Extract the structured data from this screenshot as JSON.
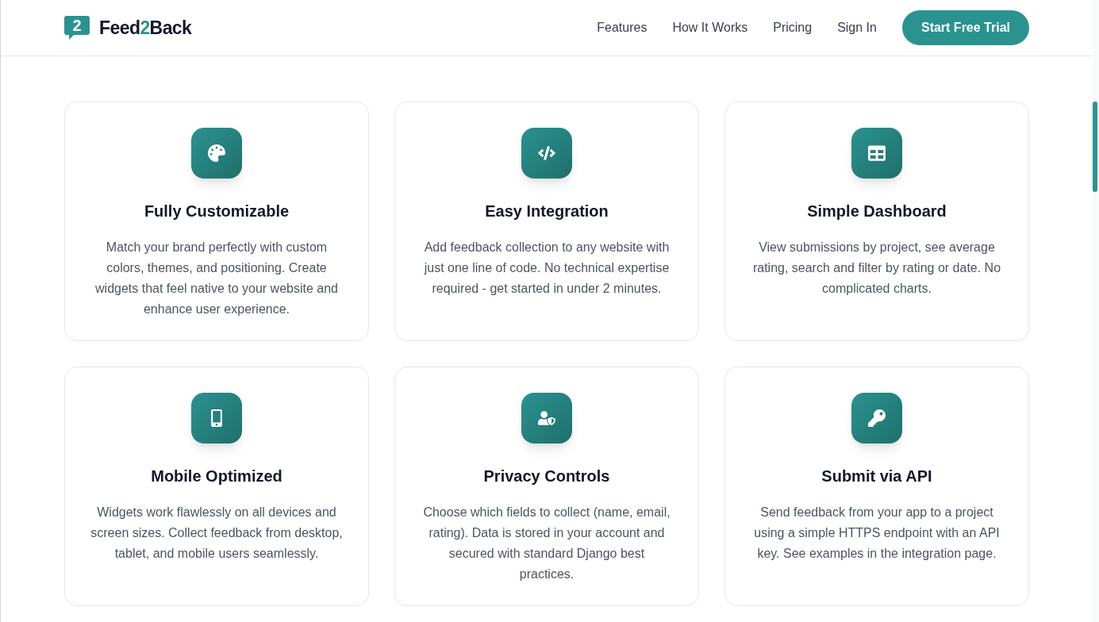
{
  "header": {
    "logo": {
      "badge": "2",
      "name_start": "Feed",
      "name_accent": "2",
      "name_end": "Back"
    },
    "nav": [
      "Features",
      "How It Works",
      "Pricing",
      "Sign In"
    ],
    "cta": "Start Free Trial"
  },
  "features": [
    {
      "kind": "palette",
      "title": "Fully Customizable",
      "text": "Match your brand perfectly with custom colors, themes, and positioning. Create widgets that feel native to your website and enhance user experience."
    },
    {
      "kind": "code",
      "title": "Easy Integration",
      "text": "Add feedback collection to any website with just one line of code. No technical expertise required - get started in under 2 minutes."
    },
    {
      "kind": "table",
      "title": "Simple Dashboard",
      "text": "View submissions by project, see average rating, search and filter by rating or date. No complicated charts."
    },
    {
      "kind": "mobile",
      "title": "Mobile Optimized",
      "text": "Widgets work flawlessly on all devices and screen sizes. Collect feedback from desktop, tablet, and mobile users seamlessly."
    },
    {
      "kind": "privacy",
      "title": "Privacy Controls",
      "text": "Choose which fields to collect (name, email, rating). Data is stored in your account and secured with standard Django best practices."
    },
    {
      "kind": "key",
      "title": "Submit via API",
      "text": "Send feedback from your app to a project using a simple HTTPS endpoint with an API key. See examples in the integration page."
    }
  ]
}
